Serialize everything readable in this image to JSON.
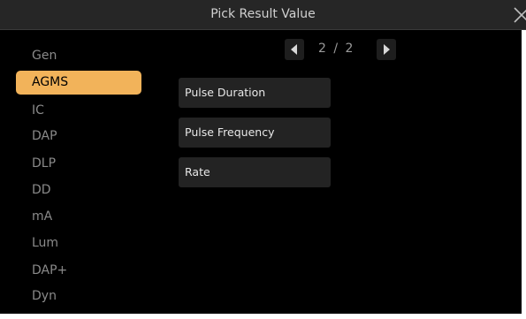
{
  "dialog": {
    "title": "Pick Result Value",
    "close_icon": "close-icon"
  },
  "sidebar": {
    "selected": "AGMS",
    "items": [
      {
        "label": "Gen",
        "active": false
      },
      {
        "label": "AGMS",
        "active": true
      },
      {
        "label": "IC",
        "active": false
      },
      {
        "label": "DAP",
        "active": false
      },
      {
        "label": "DLP",
        "active": false
      },
      {
        "label": "DD",
        "active": false
      },
      {
        "label": "mA",
        "active": false
      },
      {
        "label": "Lum",
        "active": false
      },
      {
        "label": "DAP+",
        "active": false
      },
      {
        "label": "Dyn",
        "active": false
      }
    ]
  },
  "pager": {
    "text": "2 / 2",
    "prev_icon": "triangle-left-icon",
    "next_icon": "triangle-right-icon"
  },
  "results": {
    "items": [
      {
        "label": "Pulse Duration"
      },
      {
        "label": "Pulse Frequency"
      },
      {
        "label": "Rate"
      }
    ]
  },
  "colors": {
    "accent": "#f2b35a",
    "background": "#000000",
    "titlebar": "#262626",
    "button": "#232323"
  }
}
